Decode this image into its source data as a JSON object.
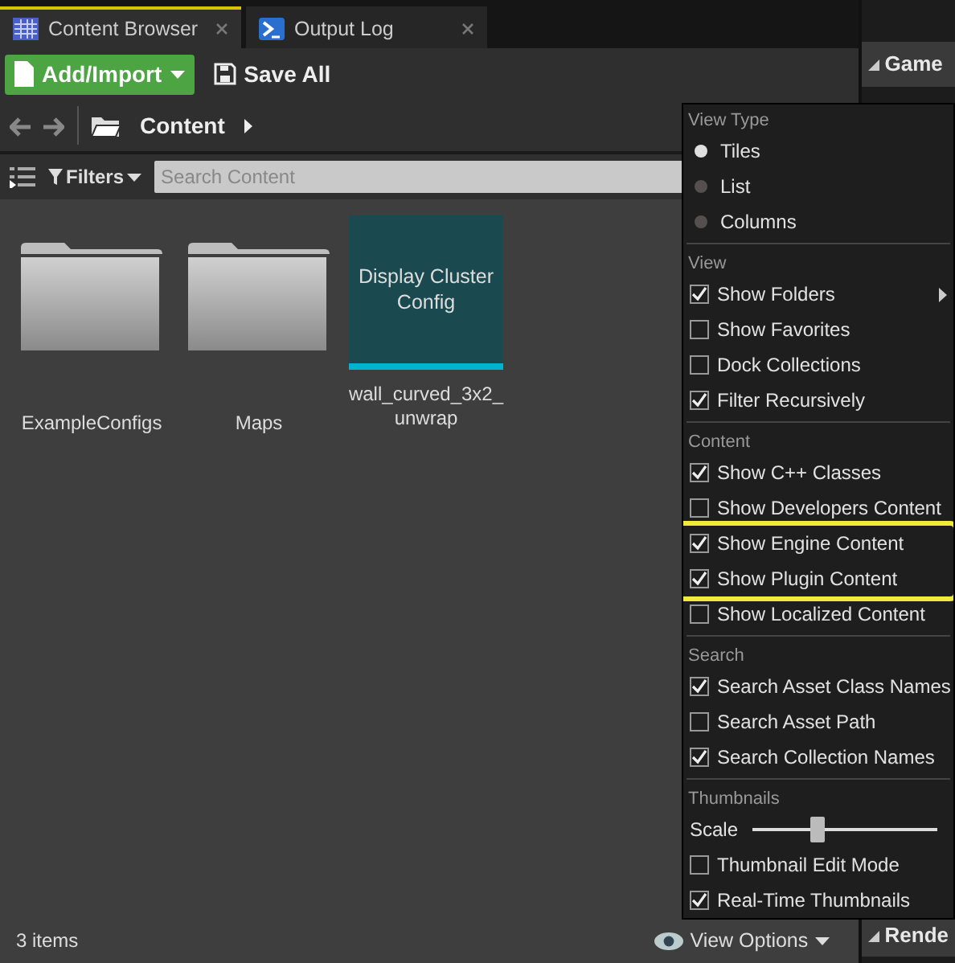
{
  "tabs": [
    {
      "label": "Content Browser",
      "kind": "grid",
      "selected": true
    },
    {
      "label": "Output Log",
      "kind": "console",
      "selected": false
    }
  ],
  "toolbar": {
    "add_import": "Add/Import",
    "save_all": "Save All"
  },
  "path": {
    "crumbs": [
      "Content"
    ]
  },
  "filters": {
    "label": "Filters",
    "search_placeholder": "Search Content"
  },
  "assets": [
    {
      "kind": "folder",
      "name": "ExampleConfigs"
    },
    {
      "kind": "folder",
      "name": "Maps"
    },
    {
      "kind": "asset",
      "thumb_text": "Display Cluster Config",
      "name": "wall_curved_3x2_ unwrap"
    }
  ],
  "status_bar": {
    "count": "3 items",
    "view_options": "View Options"
  },
  "details_panel": {
    "sections": [
      "Game",
      "Rende"
    ]
  },
  "view_menu": {
    "sections": [
      {
        "title": "View Type",
        "items": [
          {
            "kind": "radio",
            "label": "Tiles",
            "selected": true
          },
          {
            "kind": "radio",
            "label": "List",
            "selected": false
          },
          {
            "kind": "radio",
            "label": "Columns",
            "selected": false
          }
        ]
      },
      {
        "title": "View",
        "items": [
          {
            "kind": "checkbox",
            "label": "Show Folders",
            "checked": true,
            "submenu": true
          },
          {
            "kind": "checkbox",
            "label": "Show Favorites",
            "checked": false
          },
          {
            "kind": "checkbox",
            "label": "Dock Collections",
            "checked": false
          },
          {
            "kind": "checkbox",
            "label": "Filter Recursively",
            "checked": true
          }
        ]
      },
      {
        "title": "Content",
        "items": [
          {
            "kind": "checkbox",
            "label": "Show C++ Classes",
            "checked": true
          },
          {
            "kind": "checkbox",
            "label": "Show Developers Content",
            "checked": false
          },
          {
            "kind": "checkbox",
            "label": "Show Engine Content",
            "checked": true,
            "highlighted": true
          },
          {
            "kind": "checkbox",
            "label": "Show Plugin Content",
            "checked": true,
            "highlighted": true
          },
          {
            "kind": "checkbox",
            "label": "Show Localized Content",
            "checked": false
          }
        ]
      },
      {
        "title": "Search",
        "items": [
          {
            "kind": "checkbox",
            "label": "Search Asset Class Names",
            "checked": true
          },
          {
            "kind": "checkbox",
            "label": "Search Asset Path",
            "checked": false
          },
          {
            "kind": "checkbox",
            "label": "Search Collection Names",
            "checked": true
          }
        ]
      },
      {
        "title": "Thumbnails",
        "items": [
          {
            "kind": "slider",
            "label": "Scale",
            "level": 0.35
          },
          {
            "kind": "checkbox",
            "label": "Thumbnail Edit Mode",
            "checked": false
          },
          {
            "kind": "checkbox",
            "label": "Real-Time Thumbnails",
            "checked": true
          }
        ]
      }
    ]
  }
}
